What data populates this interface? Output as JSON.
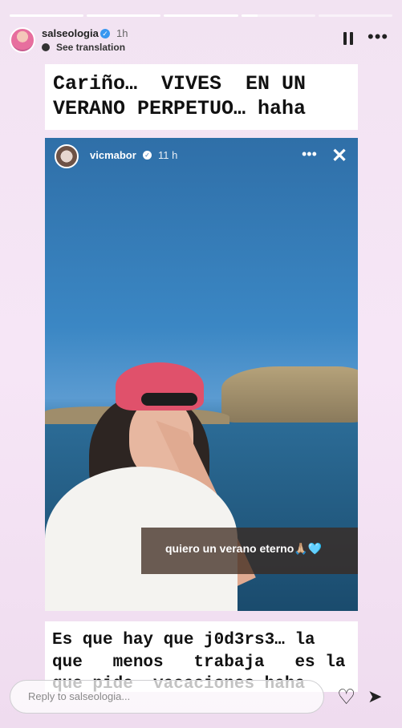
{
  "story": {
    "progress": [
      1,
      1,
      1,
      0.22,
      0
    ],
    "user": "salseologia",
    "time": "1h",
    "translation_link": "See translation"
  },
  "captions": {
    "top": [
      "Cariño…  VIVES  EN UN",
      "VERANO PERPETUO… haha"
    ],
    "bottom": [
      "Es que hay que j0d3rs3… la",
      "que   menos   trabaja   es la",
      "que pide  vacaciones haha"
    ]
  },
  "embedded": {
    "user": "vicmabor",
    "time": "11 h",
    "caption": "quiero un verano eterno🙏🏼🩵"
  },
  "footer": {
    "reply_placeholder": "Reply to salseologia..."
  },
  "icons": {
    "verified": "verified-badge-icon",
    "translate": "translate-icon",
    "pause": "pause-icon",
    "more": "more-icon",
    "close": "close-icon",
    "heart": "heart-icon",
    "send": "send-icon"
  }
}
